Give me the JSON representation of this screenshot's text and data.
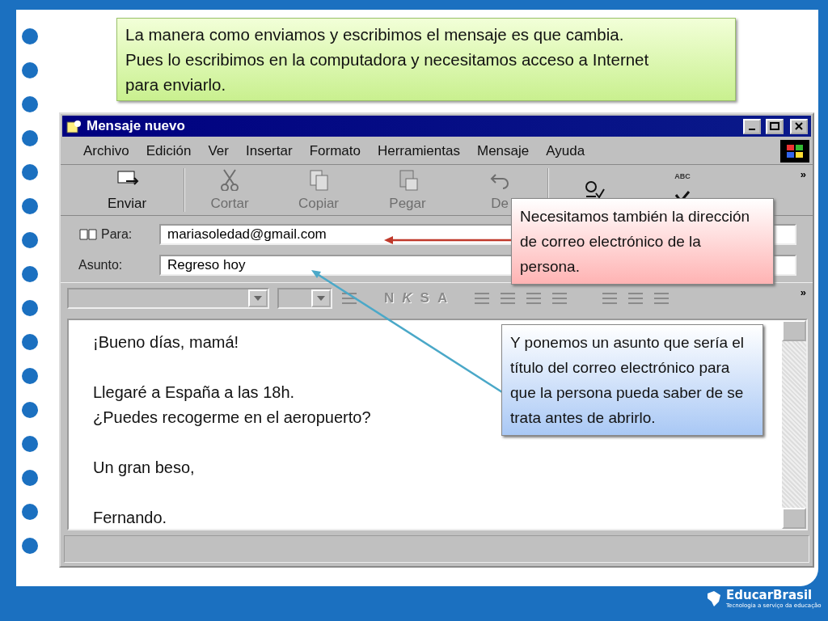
{
  "note": "La manera como enviamos y escribimos el mensaje es que cambia. Pues lo escribimos en la computadora y necesitamos acceso a Internet para enviarlo.",
  "window": {
    "title": "Mensaje nuevo",
    "menu": [
      "Archivo",
      "Edición",
      "Ver",
      "Insertar",
      "Formato",
      "Herramientas",
      "Mensaje",
      "Ayuda"
    ],
    "toolbar": [
      {
        "kind": "send",
        "label": "Enviar",
        "disabled": false
      },
      {
        "kind": "cut",
        "label": "Cortar",
        "disabled": true
      },
      {
        "kind": "copy",
        "label": "Copiar",
        "disabled": true
      },
      {
        "kind": "paste",
        "label": "Pegar",
        "disabled": true
      },
      {
        "kind": "undo",
        "label": "De",
        "disabled": true
      },
      {
        "kind": "check",
        "disabled": false
      },
      {
        "kind": "spell",
        "badge": "ABC",
        "disabled": false
      }
    ],
    "to": {
      "label": "Para:",
      "value": "mariasoledad@gmail.com"
    },
    "subject": {
      "label": "Asunto:",
      "value": "Regreso hoy"
    },
    "toolbar_more": "»",
    "format_buttons": [
      "N",
      "K",
      "S",
      "A"
    ],
    "format_more": "»",
    "body": [
      [
        "¡Bueno días, mamá!"
      ],
      [
        "Llegaré a España a las 18h.",
        "¿Puedes recogerme en el aeropuerto?"
      ],
      [
        "Un gran beso,"
      ],
      [
        "Fernando."
      ]
    ]
  },
  "callouts": [
    {
      "kind": "address",
      "text": "Necesitamos también la dirección de correo electrónico de la persona.",
      "color": "#ffb3b3"
    },
    {
      "kind": "subject",
      "text": "Y ponemos un asunto que sería el título del correo electrónico para que la persona pueda saber de se trata antes de abrirlo.",
      "color": "#a9c8f5"
    }
  ],
  "logo": {
    "name": "EducarBrasil",
    "tagline": "Tecnologia a serviço da educação"
  }
}
